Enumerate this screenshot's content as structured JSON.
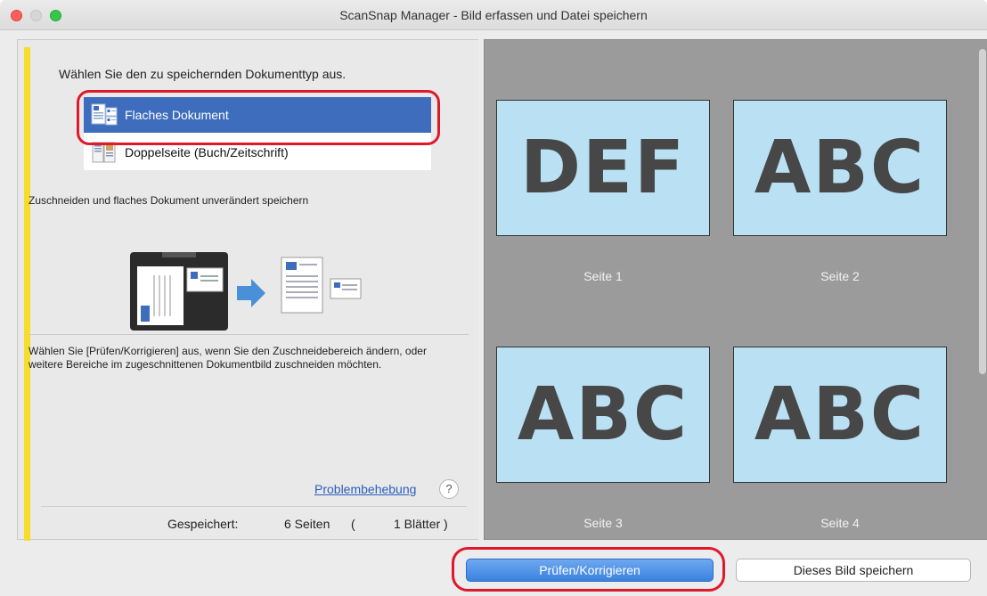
{
  "window": {
    "title": "ScanSnap Manager - Bild erfassen und Datei speichern"
  },
  "left": {
    "prompt": "Wählen Sie den zu speichernden Dokumenttyp aus.",
    "doc_types": [
      {
        "label": "Flaches Dokument",
        "selected": true
      },
      {
        "label": "Doppelseite (Buch/Zeitschrift)",
        "selected": false
      }
    ],
    "description": "Zuschneiden und flaches Dokument unverändert speichern",
    "note": "Wählen Sie [Prüfen/Korrigieren] aus, wenn Sie den Zuschneidebereich ändern, oder weitere Bereiche im zugeschnittenen Dokumentbild zuschneiden möchten.",
    "help_link": "Problembehebung",
    "help_icon": "?",
    "status": {
      "label": "Gespeichert:",
      "pages": "6 Seiten",
      "open_paren": "(",
      "sheets": "1 Blätter )"
    }
  },
  "thumbnails": [
    {
      "text": "DEF",
      "label": "Seite 1"
    },
    {
      "text": "ABC",
      "label": "Seite 2"
    },
    {
      "text": "ABC",
      "label": "Seite 3"
    },
    {
      "text": "ABC",
      "label": "Seite 4"
    }
  ],
  "buttons": {
    "check_correct": "Prüfen/Korrigieren",
    "save_image": "Dieses Bild speichern"
  },
  "colors": {
    "selection": "#3e6dbd",
    "highlight_red": "#e0182c",
    "accent_yellow": "#f6dd2a",
    "thumb_bg": "#b9e0f3"
  }
}
